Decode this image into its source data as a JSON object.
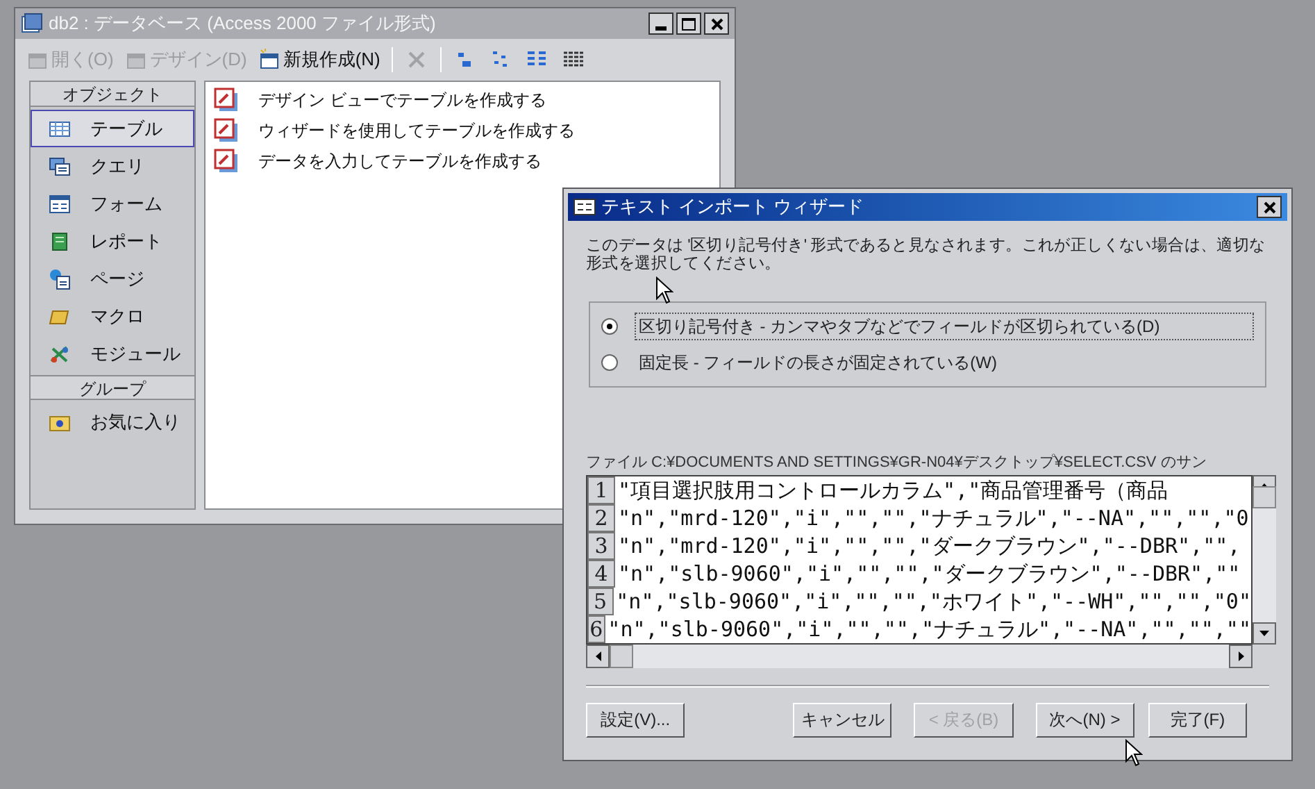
{
  "db_window": {
    "title": "db2 : データベース (Access 2000 ファイル形式)",
    "toolbar": [
      {
        "kind": "button",
        "label": "開く(O)",
        "disabled": true
      },
      {
        "kind": "button",
        "label": "デザイン(D)",
        "disabled": true
      },
      {
        "kind": "button",
        "label": "新規作成(N)",
        "disabled": false
      },
      {
        "kind": "separator"
      },
      {
        "kind": "delete",
        "disabled": true
      },
      {
        "kind": "separator"
      },
      {
        "kind": "large-icons"
      },
      {
        "kind": "small-icons"
      },
      {
        "kind": "list-view"
      },
      {
        "kind": "details-view"
      }
    ],
    "sidebar": {
      "sections": [
        {
          "header": "オブジェクト",
          "items": [
            {
              "label": "テーブル",
              "kind": "table",
              "selected": true
            },
            {
              "label": "クエリ",
              "kind": "query",
              "selected": false
            },
            {
              "label": "フォーム",
              "kind": "form",
              "selected": false
            },
            {
              "label": "レポート",
              "kind": "report",
              "selected": false
            },
            {
              "label": "ページ",
              "kind": "page",
              "selected": false
            },
            {
              "label": "マクロ",
              "kind": "macro",
              "selected": false
            },
            {
              "label": "モジュール",
              "kind": "module",
              "selected": false
            }
          ]
        },
        {
          "header": "グループ",
          "items": [
            {
              "label": "お気に入り",
              "kind": "folder",
              "selected": false
            }
          ]
        }
      ]
    },
    "list": [
      "デザイン ビューでテーブルを作成する",
      "ウィザードを使用してテーブルを作成する",
      "データを入力してテーブルを作成する"
    ]
  },
  "wizard": {
    "title": "テキスト インポート ウィザード",
    "message": "このデータは '区切り記号付き' 形式であると見なされます。これが正しくない場合は、適切な形式を選択してください。",
    "options": [
      {
        "label": "区切り記号付き - カンマやタブなどでフィールドが区切られている(D)",
        "selected": true
      },
      {
        "label": "固定長 - フィールドの長さが固定されている(W)",
        "selected": false
      }
    ],
    "file_label": "ファイル C:¥DOCUMENTS AND SETTINGS¥GR-N04¥デスクトップ¥SELECT.CSV のサン",
    "preview_rows": [
      {
        "number": "1",
        "text": "\"項目選択肢用コントロールカラム\",\"商品管理番号（商品"
      },
      {
        "number": "2",
        "text": "\"n\",\"mrd-120\",\"i\",\"\",\"\",\"ナチュラル\",\"--NA\",\"\",\"\",\"0"
      },
      {
        "number": "3",
        "text": "\"n\",\"mrd-120\",\"i\",\"\",\"\",\"ダークブラウン\",\"--DBR\",\"\","
      },
      {
        "number": "4",
        "text": "\"n\",\"slb-9060\",\"i\",\"\",\"\",\"ダークブラウン\",\"--DBR\",\"\""
      },
      {
        "number": "5",
        "text": "\"n\",\"slb-9060\",\"i\",\"\",\"\",\"ホワイト\",\"--WH\",\"\",\"\",\"0\""
      },
      {
        "number": "6",
        "text": "\"n\",\"slb-9060\",\"i\",\"\",\"\",\"ナチュラル\",\"--NA\",\"\",\"\",\"\""
      }
    ],
    "buttons": [
      {
        "label": "設定(V)...",
        "disabled": false
      },
      {
        "label": "キャンセル",
        "disabled": false
      },
      {
        "label": "< 戻る(B)",
        "disabled": true
      },
      {
        "label": "次へ(N) >",
        "disabled": false
      },
      {
        "label": "完了(F)",
        "disabled": false
      }
    ]
  }
}
